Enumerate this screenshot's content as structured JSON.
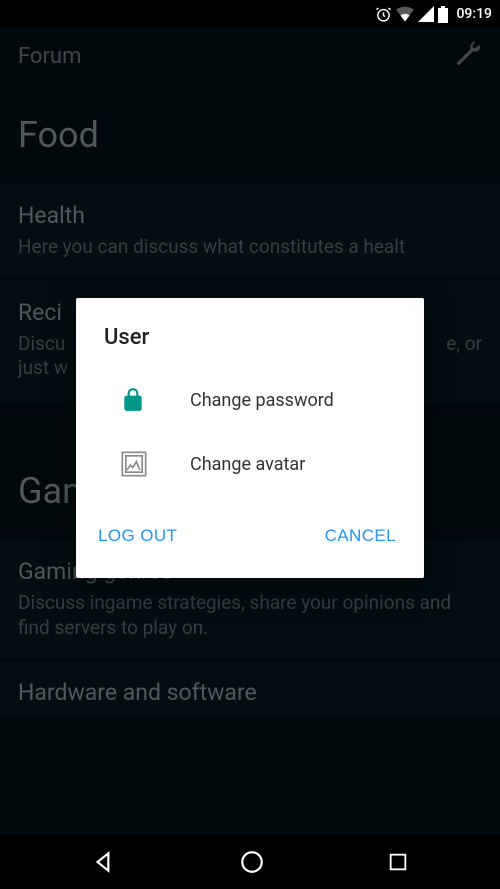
{
  "status": {
    "time": "09:19"
  },
  "appbar": {
    "title": "Forum"
  },
  "sections": {
    "food": {
      "header": "Food",
      "health": {
        "title": "Health",
        "desc": "Here you can discuss what constitutes a healt"
      },
      "recipes": {
        "title": "Reci",
        "desc1": "Discu",
        "desc2": "e, or",
        "desc3": "just w"
      }
    },
    "games": {
      "header": "Games",
      "genres": {
        "title": "Gaming genres",
        "desc": "Discuss ingame strategies, share your opinions and find servers to play on."
      },
      "hardware": {
        "title": "Hardware and software"
      }
    }
  },
  "dialog": {
    "title": "User",
    "items": {
      "change_password": "Change password",
      "change_avatar": "Change avatar"
    },
    "actions": {
      "logout": "LOG OUT",
      "cancel": "CANCEL"
    }
  }
}
